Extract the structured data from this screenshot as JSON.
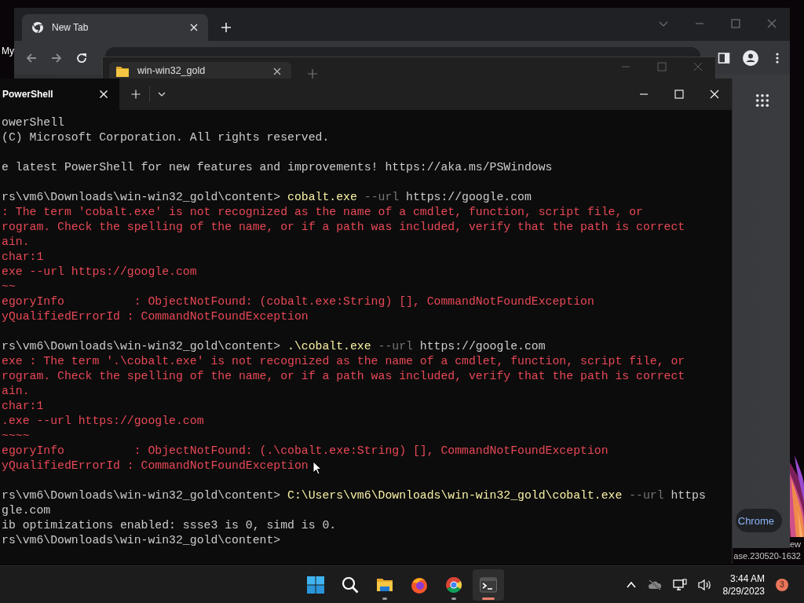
{
  "desktop": {
    "icon_label": "My",
    "watermark": [
      "ew",
      "ase.230520-1632"
    ]
  },
  "chrome": {
    "tabs": [
      {
        "label": "New Tab",
        "selected": true
      }
    ],
    "promo_button": "Chrome"
  },
  "explorer": {
    "tabs": [
      {
        "label": "win-win32_gold",
        "selected": true
      }
    ]
  },
  "terminal": {
    "tabs": [
      {
        "label": "PowerShell",
        "selected": true
      }
    ],
    "lines": [
      {
        "space_before": false,
        "spans": [
          {
            "kind": "text",
            "text": "owerShell"
          }
        ]
      },
      {
        "space_before": false,
        "spans": [
          {
            "kind": "text",
            "text": "(C) Microsoft Corporation. All rights reserved."
          }
        ]
      },
      {
        "space_before": true,
        "spans": [
          {
            "kind": "text",
            "text": "e latest PowerShell for new features and improvements! https://aka.ms/PSWindows"
          }
        ]
      },
      {
        "space_before": true,
        "spans": [
          {
            "kind": "text",
            "text": "rs\\vm6\\Downloads\\win-win32_gold\\content> "
          },
          {
            "kind": "command",
            "text": "cobalt.exe"
          },
          {
            "kind": "param",
            "text": " --url"
          },
          {
            "kind": "text",
            "text": " https://google.com"
          }
        ]
      },
      {
        "space_before": false,
        "spans": [
          {
            "kind": "error",
            "text": ": The term 'cobalt.exe' is not recognized as the name of a cmdlet, function, script file, or"
          }
        ]
      },
      {
        "space_before": false,
        "spans": [
          {
            "kind": "error",
            "text": "rogram. Check the spelling of the name, or if a path was included, verify that the path is correct"
          }
        ]
      },
      {
        "space_before": false,
        "spans": [
          {
            "kind": "error",
            "text": "ain."
          }
        ]
      },
      {
        "space_before": false,
        "spans": [
          {
            "kind": "error",
            "text": "char:1"
          }
        ]
      },
      {
        "space_before": false,
        "spans": [
          {
            "kind": "error",
            "text": "exe --url https://google.com"
          }
        ]
      },
      {
        "space_before": false,
        "spans": [
          {
            "kind": "error",
            "text": "~~"
          }
        ]
      },
      {
        "space_before": false,
        "spans": [
          {
            "kind": "error",
            "text": "egoryInfo          : ObjectNotFound: (cobalt.exe:String) [], CommandNotFoundException"
          }
        ]
      },
      {
        "space_before": false,
        "spans": [
          {
            "kind": "error",
            "text": "yQualifiedErrorId : CommandNotFoundException"
          }
        ]
      },
      {
        "space_before": true,
        "spans": [
          {
            "kind": "text",
            "text": "rs\\vm6\\Downloads\\win-win32_gold\\content> "
          },
          {
            "kind": "command",
            "text": ".\\cobalt.exe"
          },
          {
            "kind": "param",
            "text": " --url"
          },
          {
            "kind": "text",
            "text": " https://google.com"
          }
        ]
      },
      {
        "space_before": false,
        "spans": [
          {
            "kind": "error",
            "text": "exe : The term '.\\cobalt.exe' is not recognized as the name of a cmdlet, function, script file, or"
          }
        ]
      },
      {
        "space_before": false,
        "spans": [
          {
            "kind": "error",
            "text": "rogram. Check the spelling of the name, or if a path was included, verify that the path is correct"
          }
        ]
      },
      {
        "space_before": false,
        "spans": [
          {
            "kind": "error",
            "text": "ain."
          }
        ]
      },
      {
        "space_before": false,
        "spans": [
          {
            "kind": "error",
            "text": "char:1"
          }
        ]
      },
      {
        "space_before": false,
        "spans": [
          {
            "kind": "error",
            "text": ".exe --url https://google.com"
          }
        ]
      },
      {
        "space_before": false,
        "spans": [
          {
            "kind": "error",
            "text": "~~~~"
          }
        ]
      },
      {
        "space_before": false,
        "spans": [
          {
            "kind": "error",
            "text": "egoryInfo          : ObjectNotFound: (.\\cobalt.exe:String) [], CommandNotFoundException"
          }
        ]
      },
      {
        "space_before": false,
        "spans": [
          {
            "kind": "error",
            "text": "yQualifiedErrorId : CommandNotFoundException"
          }
        ]
      },
      {
        "space_before": true,
        "spans": [
          {
            "kind": "text",
            "text": "rs\\vm6\\Downloads\\win-win32_gold\\content> "
          },
          {
            "kind": "command",
            "text": "C:\\Users\\vm6\\Downloads\\win-win32_gold\\cobalt.exe"
          },
          {
            "kind": "param",
            "text": " --url"
          },
          {
            "kind": "text",
            "text": " https"
          }
        ]
      },
      {
        "space_before": false,
        "spans": [
          {
            "kind": "text",
            "text": "gle.com"
          }
        ]
      },
      {
        "space_before": false,
        "spans": [
          {
            "kind": "text",
            "text": "ib optimizations enabled: ssse3 is 0, simd is 0."
          }
        ]
      },
      {
        "space_before": false,
        "spans": [
          {
            "kind": "text",
            "text": "rs\\vm6\\Downloads\\win-win32_gold\\content>"
          }
        ]
      }
    ]
  },
  "taskbar": {
    "apps": [
      {
        "kind": "start",
        "running": false,
        "selected": false
      },
      {
        "kind": "search",
        "running": false,
        "selected": false
      },
      {
        "kind": "files",
        "running": true,
        "selected": false
      },
      {
        "kind": "firefox",
        "running": false,
        "selected": false
      },
      {
        "kind": "chrome",
        "running": true,
        "selected": false
      },
      {
        "kind": "terminal",
        "running": true,
        "selected": true
      }
    ],
    "clock": {
      "time": "3:44 AM",
      "date": "8/29/2023"
    },
    "notification_count": "3"
  }
}
